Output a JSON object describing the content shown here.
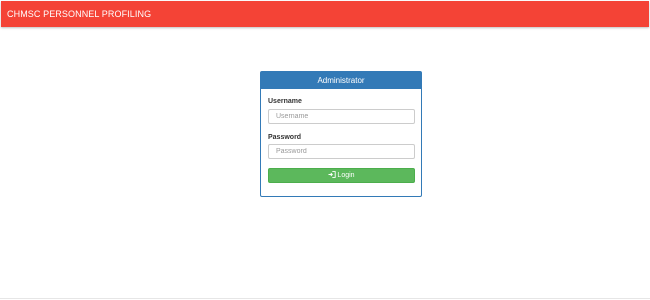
{
  "navbar": {
    "brand": "CHMSC PERSONNEL PROFILING",
    "color": "#f44336"
  },
  "login_panel": {
    "heading": "Administrator",
    "heading_color": "#337ab7",
    "username": {
      "label": "Username",
      "placeholder": "Username",
      "value": ""
    },
    "password": {
      "label": "Password",
      "placeholder": "Password",
      "value": ""
    },
    "login_button": {
      "label": "Login",
      "icon": "sign-in-icon",
      "color": "#5cb85c"
    }
  }
}
